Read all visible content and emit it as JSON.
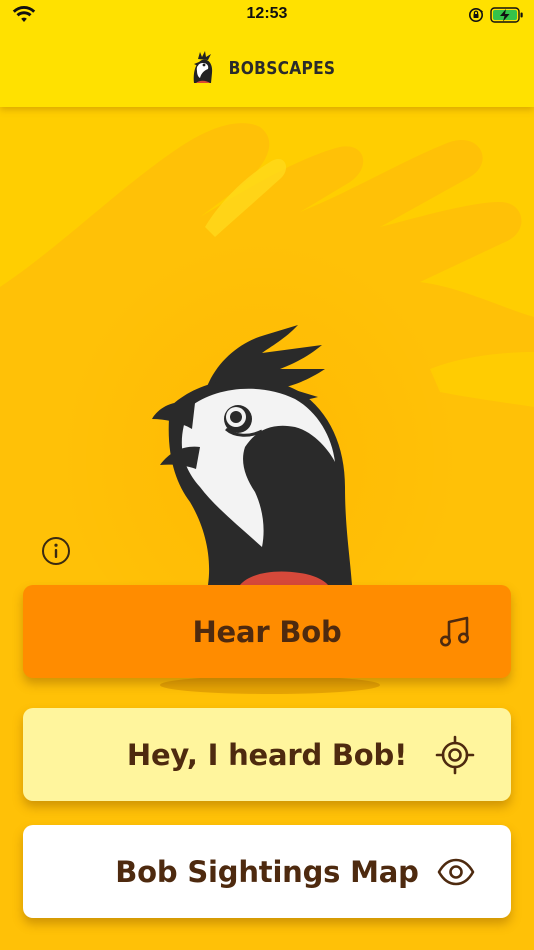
{
  "status_bar": {
    "time": "12:53",
    "icons": [
      "wifi-icon",
      "orientation-lock-icon",
      "battery-charging-icon"
    ]
  },
  "header": {
    "logo_text": "BOBSCAPES",
    "logo_icon": "quail-logo-icon"
  },
  "info": {
    "icon": "info-icon"
  },
  "actions": {
    "hear_bob": {
      "label": "Hear Bob",
      "icon": "music-note-icon"
    },
    "heard_bob": {
      "label": "Hey, I heard Bob!",
      "icon": "crosshair-icon"
    },
    "sightings_map": {
      "label": "Bob Sightings Map",
      "icon": "eye-icon"
    }
  },
  "colors": {
    "header_bg": "#ffe100",
    "page_bg": "#ffc107",
    "hear_button": "#ff8c00",
    "heard_button": "#fff59d",
    "map_button": "#ffffff",
    "label_text": "#4e2a0f"
  }
}
